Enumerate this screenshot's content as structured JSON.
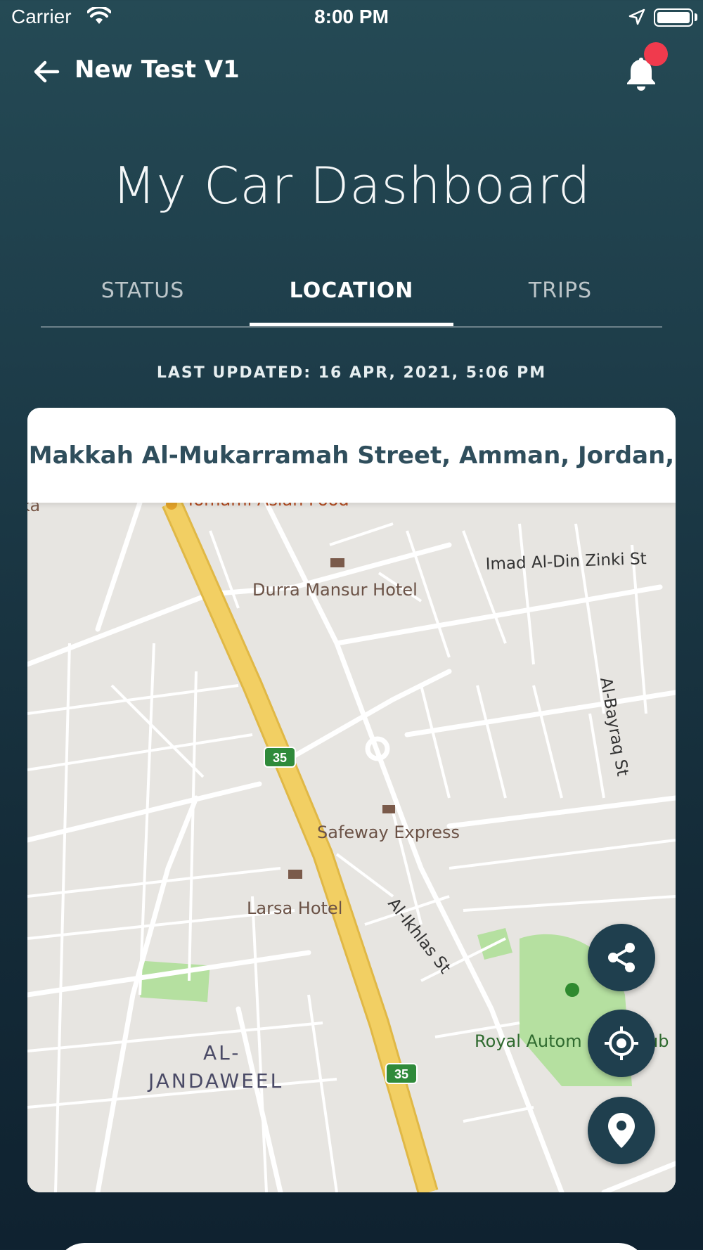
{
  "status_bar": {
    "carrier": "Carrier",
    "time": "8:00 PM"
  },
  "header": {
    "title": "New Test V1",
    "notification_badge_color": "#f03a4d"
  },
  "page": {
    "title": "My Car Dashboard"
  },
  "tabs": [
    {
      "label": "STATUS",
      "active": false
    },
    {
      "label": "LOCATION",
      "active": true
    },
    {
      "label": "TRIPS",
      "active": false
    }
  ],
  "location": {
    "last_updated": "LAST UPDATED: 16 APR, 2021, 5:06 PM",
    "address": "Makkah Al-Mukarramah Street, Amman, Jordan,"
  },
  "map": {
    "labels": {
      "durra": "Durra Mansur Hotel",
      "imad": "Imad Al-Din Zinki St",
      "bayraq": "Al-Bayraq St",
      "safeway": "Safeway Express",
      "larsa": "Larsa Hotel",
      "ikhlas": "Al-Ikhlas St",
      "royal": "Royal Autom",
      "royal_tail": "ub",
      "jandaweel_1": "AL-",
      "jandaweel_2": "JANDAWEEL",
      "yomami": "Yomami Asian Food",
      "ka": "ka",
      "route": "35"
    }
  },
  "actions": {
    "share_icon": "share-icon",
    "locate_icon": "crosshair-icon",
    "pin_icon": "map-pin-icon"
  },
  "colors": {
    "accent": "#1f3f4e",
    "address_text": "#2f4e5c",
    "highway": "#f2cf63"
  }
}
